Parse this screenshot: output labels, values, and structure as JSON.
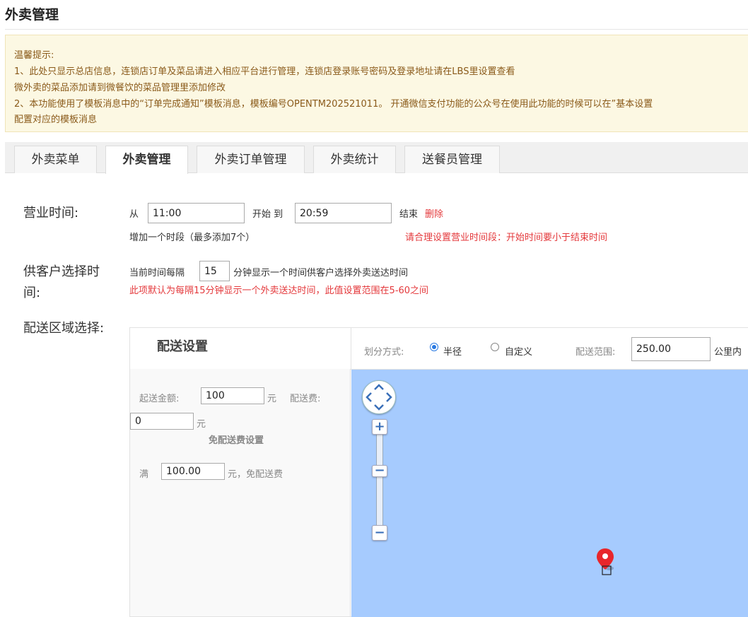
{
  "page": {
    "title": "外卖管理"
  },
  "notice": {
    "title": "温馨提示:",
    "line1": "1、此处只显示总店信息，连锁店订单及菜品请进入相应平台进行管理，连锁店登录账号密码及登录地址请在LBS里设置查看",
    "line2": "微外卖的菜品添加请到微餐饮的菜品管理里添加修改",
    "line3": "2、本功能使用了模板消息中的“订单完成通知”模板消息，模板编号OPENTM202521011。 开通微信支付功能的公众号在使用此功能的时候可以在”基本设置",
    "line4": "配置对应的模板消息"
  },
  "tabs": [
    {
      "label": "外卖菜单",
      "active": false
    },
    {
      "label": "外卖管理",
      "active": true
    },
    {
      "label": "外卖订单管理",
      "active": false
    },
    {
      "label": "外卖统计",
      "active": false
    },
    {
      "label": "送餐员管理",
      "active": false
    }
  ],
  "business_hours": {
    "label": "营业时间:",
    "from_label": "从",
    "start_value": "11:00",
    "start_label": "开始 到",
    "end_value": "20:59",
    "end_label": "结束",
    "delete_link": "删除",
    "add_slot": "增加一个时段（最多添加7个）",
    "warning": "请合理设置营业时间段：开始时间要小于结束时间"
  },
  "customer_time": {
    "label_line1": "供客户选择时",
    "label_line2": "间:",
    "prefix": "当前时间每隔",
    "interval_value": "15",
    "suffix": "分钟显示一个时间供客户选择外卖送达时间",
    "hint": "此项默认为每隔15分钟显示一个外卖送达时间，此值设置范围在5-60之间"
  },
  "delivery": {
    "label": "配送区域选择:",
    "settings_title": "配送设置",
    "division_label": "划分方式:",
    "option_radius": "半径",
    "option_custom": "自定义",
    "selected_option": "半径",
    "range_label": "配送范围:",
    "range_value": "250.00",
    "range_unit": "公里内",
    "min_amount_label": "起送金额:",
    "min_amount_value": "100",
    "yuan": "元",
    "fee_label": "配送费:",
    "fee_value": "0",
    "fee_unit": "元",
    "free_title": "免配送费设置",
    "free_prefix": "满",
    "free_value": "100.00",
    "free_suffix": "元，免配送费"
  },
  "map": {
    "zoom_in": "+",
    "zoom_out": "−",
    "colors": {
      "water": "#a6cbfe",
      "marker": "#e8262b"
    }
  }
}
